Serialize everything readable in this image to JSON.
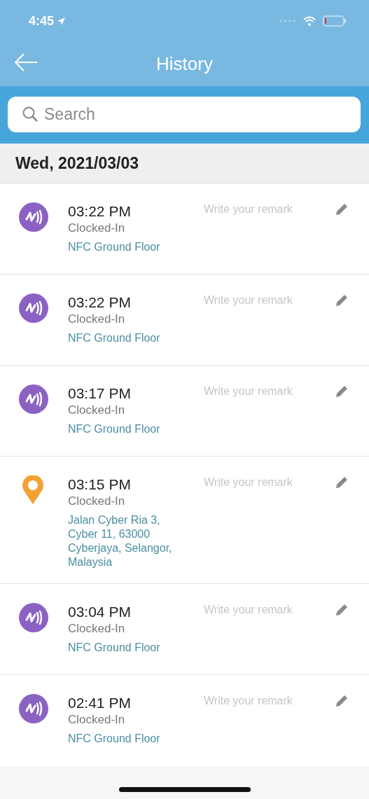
{
  "status_bar": {
    "time": "4:45"
  },
  "header": {
    "title": "History"
  },
  "search": {
    "placeholder": "Search"
  },
  "date_header": "Wed, 2021/03/03",
  "records": [
    {
      "kind": "nfc",
      "time": "03:22 PM",
      "status": "Clocked-In",
      "location": "NFC Ground Floor",
      "remark_placeholder": "Write your remark"
    },
    {
      "kind": "nfc",
      "time": "03:22 PM",
      "status": "Clocked-In",
      "location": "NFC Ground Floor",
      "remark_placeholder": "Write your remark"
    },
    {
      "kind": "nfc",
      "time": "03:17 PM",
      "status": "Clocked-In",
      "location": "NFC Ground Floor",
      "remark_placeholder": "Write your remark"
    },
    {
      "kind": "gps",
      "time": "03:15 PM",
      "status": "Clocked-In",
      "location": "Jalan Cyber Ria 3, Cyber 11, 63000 Cyberjaya, Selangor, Malaysia",
      "remark_placeholder": "Write your remark"
    },
    {
      "kind": "nfc",
      "time": "03:04 PM",
      "status": "Clocked-In",
      "location": "NFC Ground Floor",
      "remark_placeholder": "Write your remark"
    },
    {
      "kind": "nfc",
      "time": "02:41 PM",
      "status": "Clocked-In",
      "location": "NFC Ground Floor",
      "remark_placeholder": "Write your remark"
    }
  ]
}
